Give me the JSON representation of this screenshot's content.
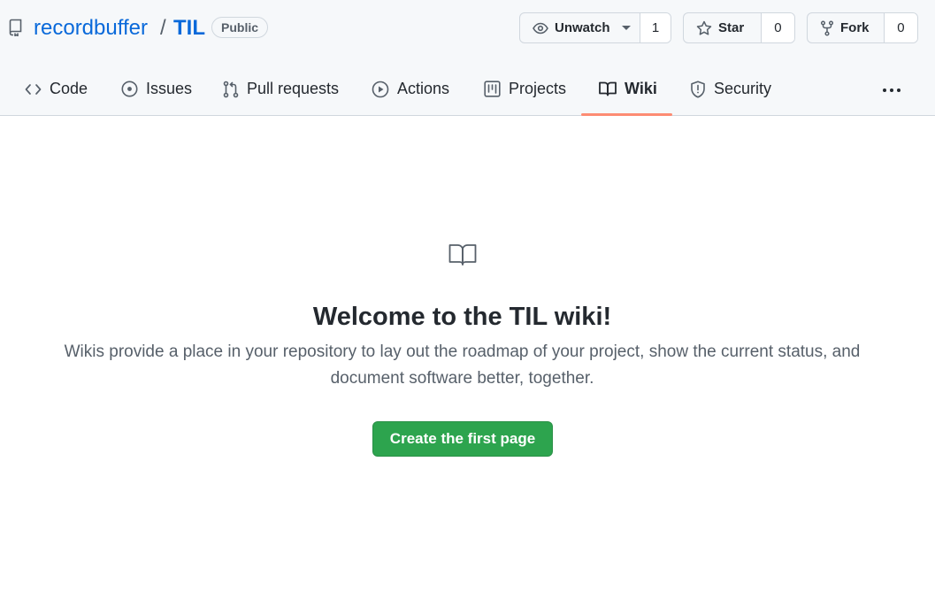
{
  "repo": {
    "owner": "recordbuffer",
    "separator": "/",
    "name": "TIL",
    "visibility": "Public"
  },
  "actions": {
    "watch": {
      "label": "Unwatch",
      "count": "1"
    },
    "star": {
      "label": "Star",
      "count": "0"
    },
    "fork": {
      "label": "Fork",
      "count": "0"
    }
  },
  "tabs": [
    {
      "label": "Code",
      "icon": "code-icon"
    },
    {
      "label": "Issues",
      "icon": "issue-icon"
    },
    {
      "label": "Pull requests",
      "icon": "pull-request-icon"
    },
    {
      "label": "Actions",
      "icon": "play-icon"
    },
    {
      "label": "Projects",
      "icon": "project-icon"
    },
    {
      "label": "Wiki",
      "icon": "book-icon",
      "active": true
    },
    {
      "label": "Security",
      "icon": "shield-icon"
    }
  ],
  "wiki": {
    "title": "Welcome to the TIL wiki!",
    "description": "Wikis provide a place in your repository to lay out the roadmap of your project, show the current status, and document software better, together.",
    "button_label": "Create the first page"
  },
  "colors": {
    "link": "#0969da",
    "active_tab_underline": "#fd8c73",
    "primary_button": "#2da44e",
    "header_background": "#f6f8fa"
  }
}
